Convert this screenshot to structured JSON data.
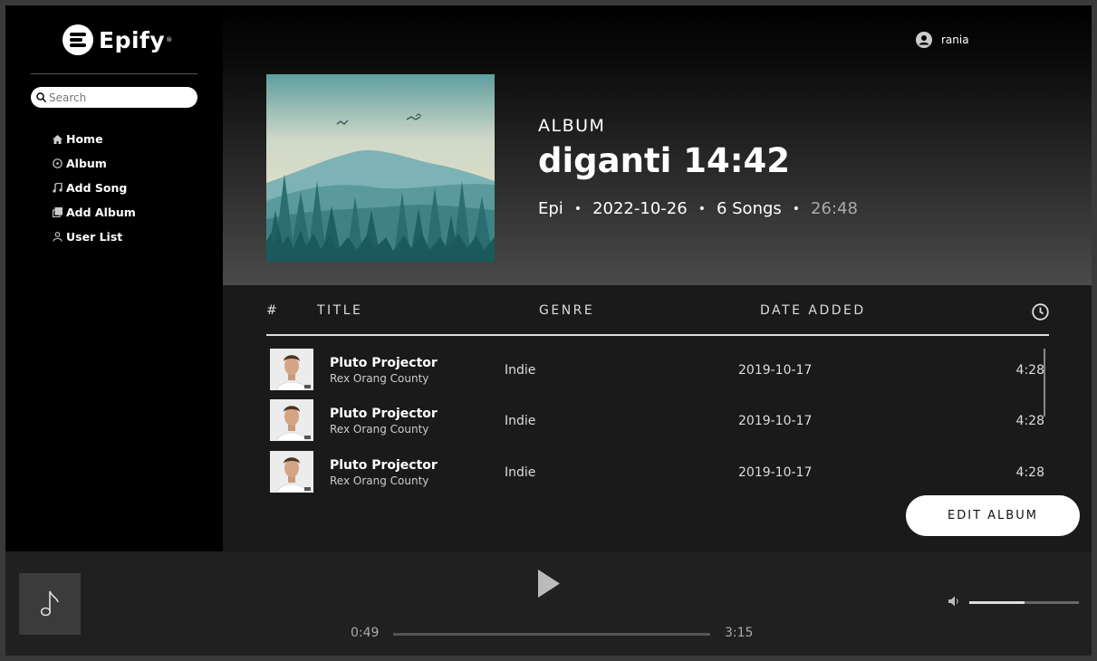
{
  "brand": {
    "name": "Epify",
    "reg": "®"
  },
  "search": {
    "placeholder": "Search"
  },
  "sidebar": {
    "items": [
      {
        "label": "Home",
        "icon": "home-icon"
      },
      {
        "label": "Album",
        "icon": "disc-icon"
      },
      {
        "label": "Add Song",
        "icon": "music-note-icon"
      },
      {
        "label": "Add Album",
        "icon": "stacked-squares-icon"
      },
      {
        "label": "User List",
        "icon": "person-icon"
      }
    ]
  },
  "user": {
    "name": "rania",
    "icon": "user-circle-icon"
  },
  "album": {
    "label": "ALBUM",
    "title": "diganti 14:42",
    "artist": "Epi",
    "date": "2022-10-26",
    "songs": "6 Songs",
    "duration": "26:48",
    "separator": "•"
  },
  "table": {
    "headers": {
      "number": "#",
      "title": "TITLE",
      "genre": "GENRE",
      "date_added": "DATE ADDED",
      "duration_icon": "clock-icon"
    },
    "rows": [
      {
        "title": "Pluto Projector",
        "artist": "Rex Orang County",
        "genre": "Indie",
        "date": "2019-10-17",
        "length": "4:28"
      },
      {
        "title": "Pluto Projector",
        "artist": "Rex Orang County",
        "genre": "Indie",
        "date": "2019-10-17",
        "length": "4:28"
      },
      {
        "title": "Pluto Projector",
        "artist": "Rex Orang County",
        "genre": "Indie",
        "date": "2019-10-17",
        "length": "4:28"
      }
    ]
  },
  "edit_button": {
    "label": "EDIT ALBUM"
  },
  "player": {
    "current_time": "0:49",
    "total_time": "3:15",
    "progress": 0,
    "volume": 0.5,
    "placeholder_icon": "music-note-icon",
    "play_icon": "play-icon",
    "volume_icon": "speaker-icon"
  },
  "colors": {
    "background": "#1a1a1a",
    "sidebar": "#000000",
    "accent": "#ffffff"
  }
}
